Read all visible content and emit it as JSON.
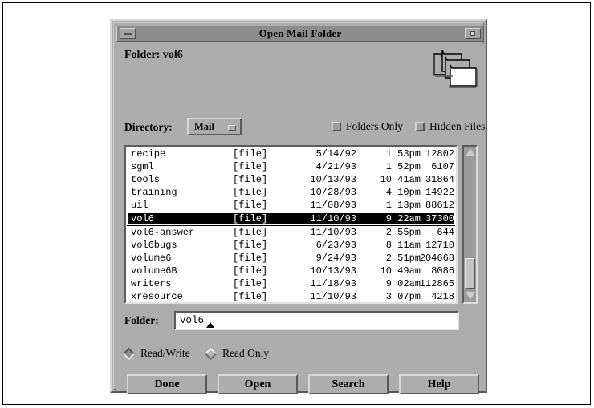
{
  "window": {
    "title": "Open Mail Folder",
    "minimize_icon": "minimize-icon",
    "maximize_icon": "maximize-icon"
  },
  "header": {
    "folder_heading": "Folder: vol6",
    "folder_stack_icon": "folder-stack-icon"
  },
  "directory": {
    "label": "Directory:",
    "selected_option": "Mail",
    "options": [
      "Mail"
    ],
    "menu_indicator_icon": "option-menu-indicator-icon"
  },
  "options": {
    "folders_only": {
      "label": "Folders Only",
      "checked": false
    },
    "hidden_files": {
      "label": "Hidden Files",
      "checked": false
    }
  },
  "file_list": {
    "rows": [
      {
        "name": "recipe",
        "type": "[file]",
        "date": "5/14/92",
        "time": "1 53pm",
        "size": "12802",
        "selected": false
      },
      {
        "name": "sgml",
        "type": "[file]",
        "date": "4/21/93",
        "time": "1 52pm",
        "size": "6107",
        "selected": false
      },
      {
        "name": "tools",
        "type": "[file]",
        "date": "10/13/93",
        "time": "10 41am",
        "size": "31864",
        "selected": false
      },
      {
        "name": "training",
        "type": "[file]",
        "date": "10/28/93",
        "time": "4 10pm",
        "size": "14922",
        "selected": false
      },
      {
        "name": "uil",
        "type": "[file]",
        "date": "11/08/93",
        "time": "1 13pm",
        "size": "88612",
        "selected": false
      },
      {
        "name": "vol6",
        "type": "[file]",
        "date": "11/10/93",
        "time": "9 22am",
        "size": "37300",
        "selected": true
      },
      {
        "name": "vol6-answer",
        "type": "[file]",
        "date": "11/10/93",
        "time": "2 55pm",
        "size": "644",
        "selected": false
      },
      {
        "name": "vol6bugs",
        "type": "[file]",
        "date": "6/23/93",
        "time": "8 11am",
        "size": "12710",
        "selected": false
      },
      {
        "name": "volume6",
        "type": "[file]",
        "date": "9/24/93",
        "time": "2 51pm",
        "size": "204668",
        "selected": false
      },
      {
        "name": "volume6B",
        "type": "[file]",
        "date": "10/13/93",
        "time": "10 49am",
        "size": "8086",
        "selected": false
      },
      {
        "name": "writers",
        "type": "[file]",
        "date": "11/18/93",
        "time": "9 02am",
        "size": "112865",
        "selected": false
      },
      {
        "name": "xresource",
        "type": "[file]",
        "date": "11/10/93",
        "time": "3 07pm",
        "size": "4218",
        "selected": false
      }
    ],
    "scrollbar": {
      "up_arrow_icon": "scroll-up-arrow-icon",
      "down_arrow_icon": "scroll-down-arrow-icon"
    }
  },
  "folder_field": {
    "label": "Folder:",
    "value": "vol6",
    "placeholder": ""
  },
  "access_mode": {
    "read_write": {
      "label": "Read/Write",
      "selected": true
    },
    "read_only": {
      "label": "Read Only",
      "selected": false
    }
  },
  "buttons": {
    "done": "Done",
    "open": "Open",
    "search": "Search",
    "help": "Help"
  },
  "colors": {
    "window_face": "#adadad",
    "titlebar": "#8c8c8c",
    "list_background": "#ffffff",
    "selection": "#000000",
    "text": "#000000"
  }
}
